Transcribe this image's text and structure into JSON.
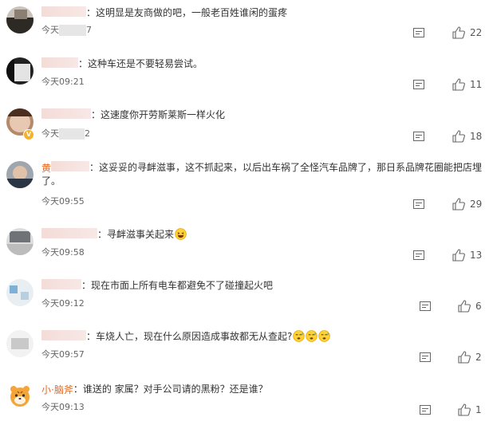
{
  "comments": [
    {
      "text": "：这明显是友商做的吧，一般老百姓谁闲的蛋疼",
      "time_prefix": "今天",
      "time_suffix": "7",
      "likes": "22"
    },
    {
      "text": "：这种车还是不要轻易尝试。",
      "time_prefix": "今天09:21",
      "likes": "11"
    },
    {
      "text": "：这速度你开劳斯莱斯一样火化",
      "time_prefix": "今天",
      "time_suffix": "2",
      "likes": "18",
      "badge": "V"
    },
    {
      "name_visible": "黄",
      "text": "：这妥妥的寻衅滋事，这不抓起来，以后出车祸了全怪汽车品牌了，那日系品牌花圈能把店埋",
      "text_line2": "了。",
      "time_prefix": "今天09:55",
      "likes": "29"
    },
    {
      "text": "：寻衅滋事关起来",
      "time_prefix": "今天09:58",
      "likes": "13"
    },
    {
      "text": "：现在市面上所有电车都避免不了碰撞起火吧",
      "time_prefix": "今天09:12",
      "likes": "6"
    },
    {
      "text": "：车烧人亡，现在什么原因造成事故都无从查起?",
      "time_prefix": "今天09:57",
      "likes": "2"
    },
    {
      "name": "小·脑斧",
      "text": "：谁送的 家属？对手公司请的黑粉？还是谁？",
      "time_prefix": "今天09:13",
      "likes": "1"
    }
  ],
  "icons": {
    "reply": "comment-icon",
    "like": "thumbs-up-icon",
    "emoji_laugh": "laughing-emoji",
    "emoji_sweat": "sweat-emoji"
  },
  "colors": {
    "name_orange": "#e86722",
    "text": "#333333",
    "time": "#666666"
  }
}
